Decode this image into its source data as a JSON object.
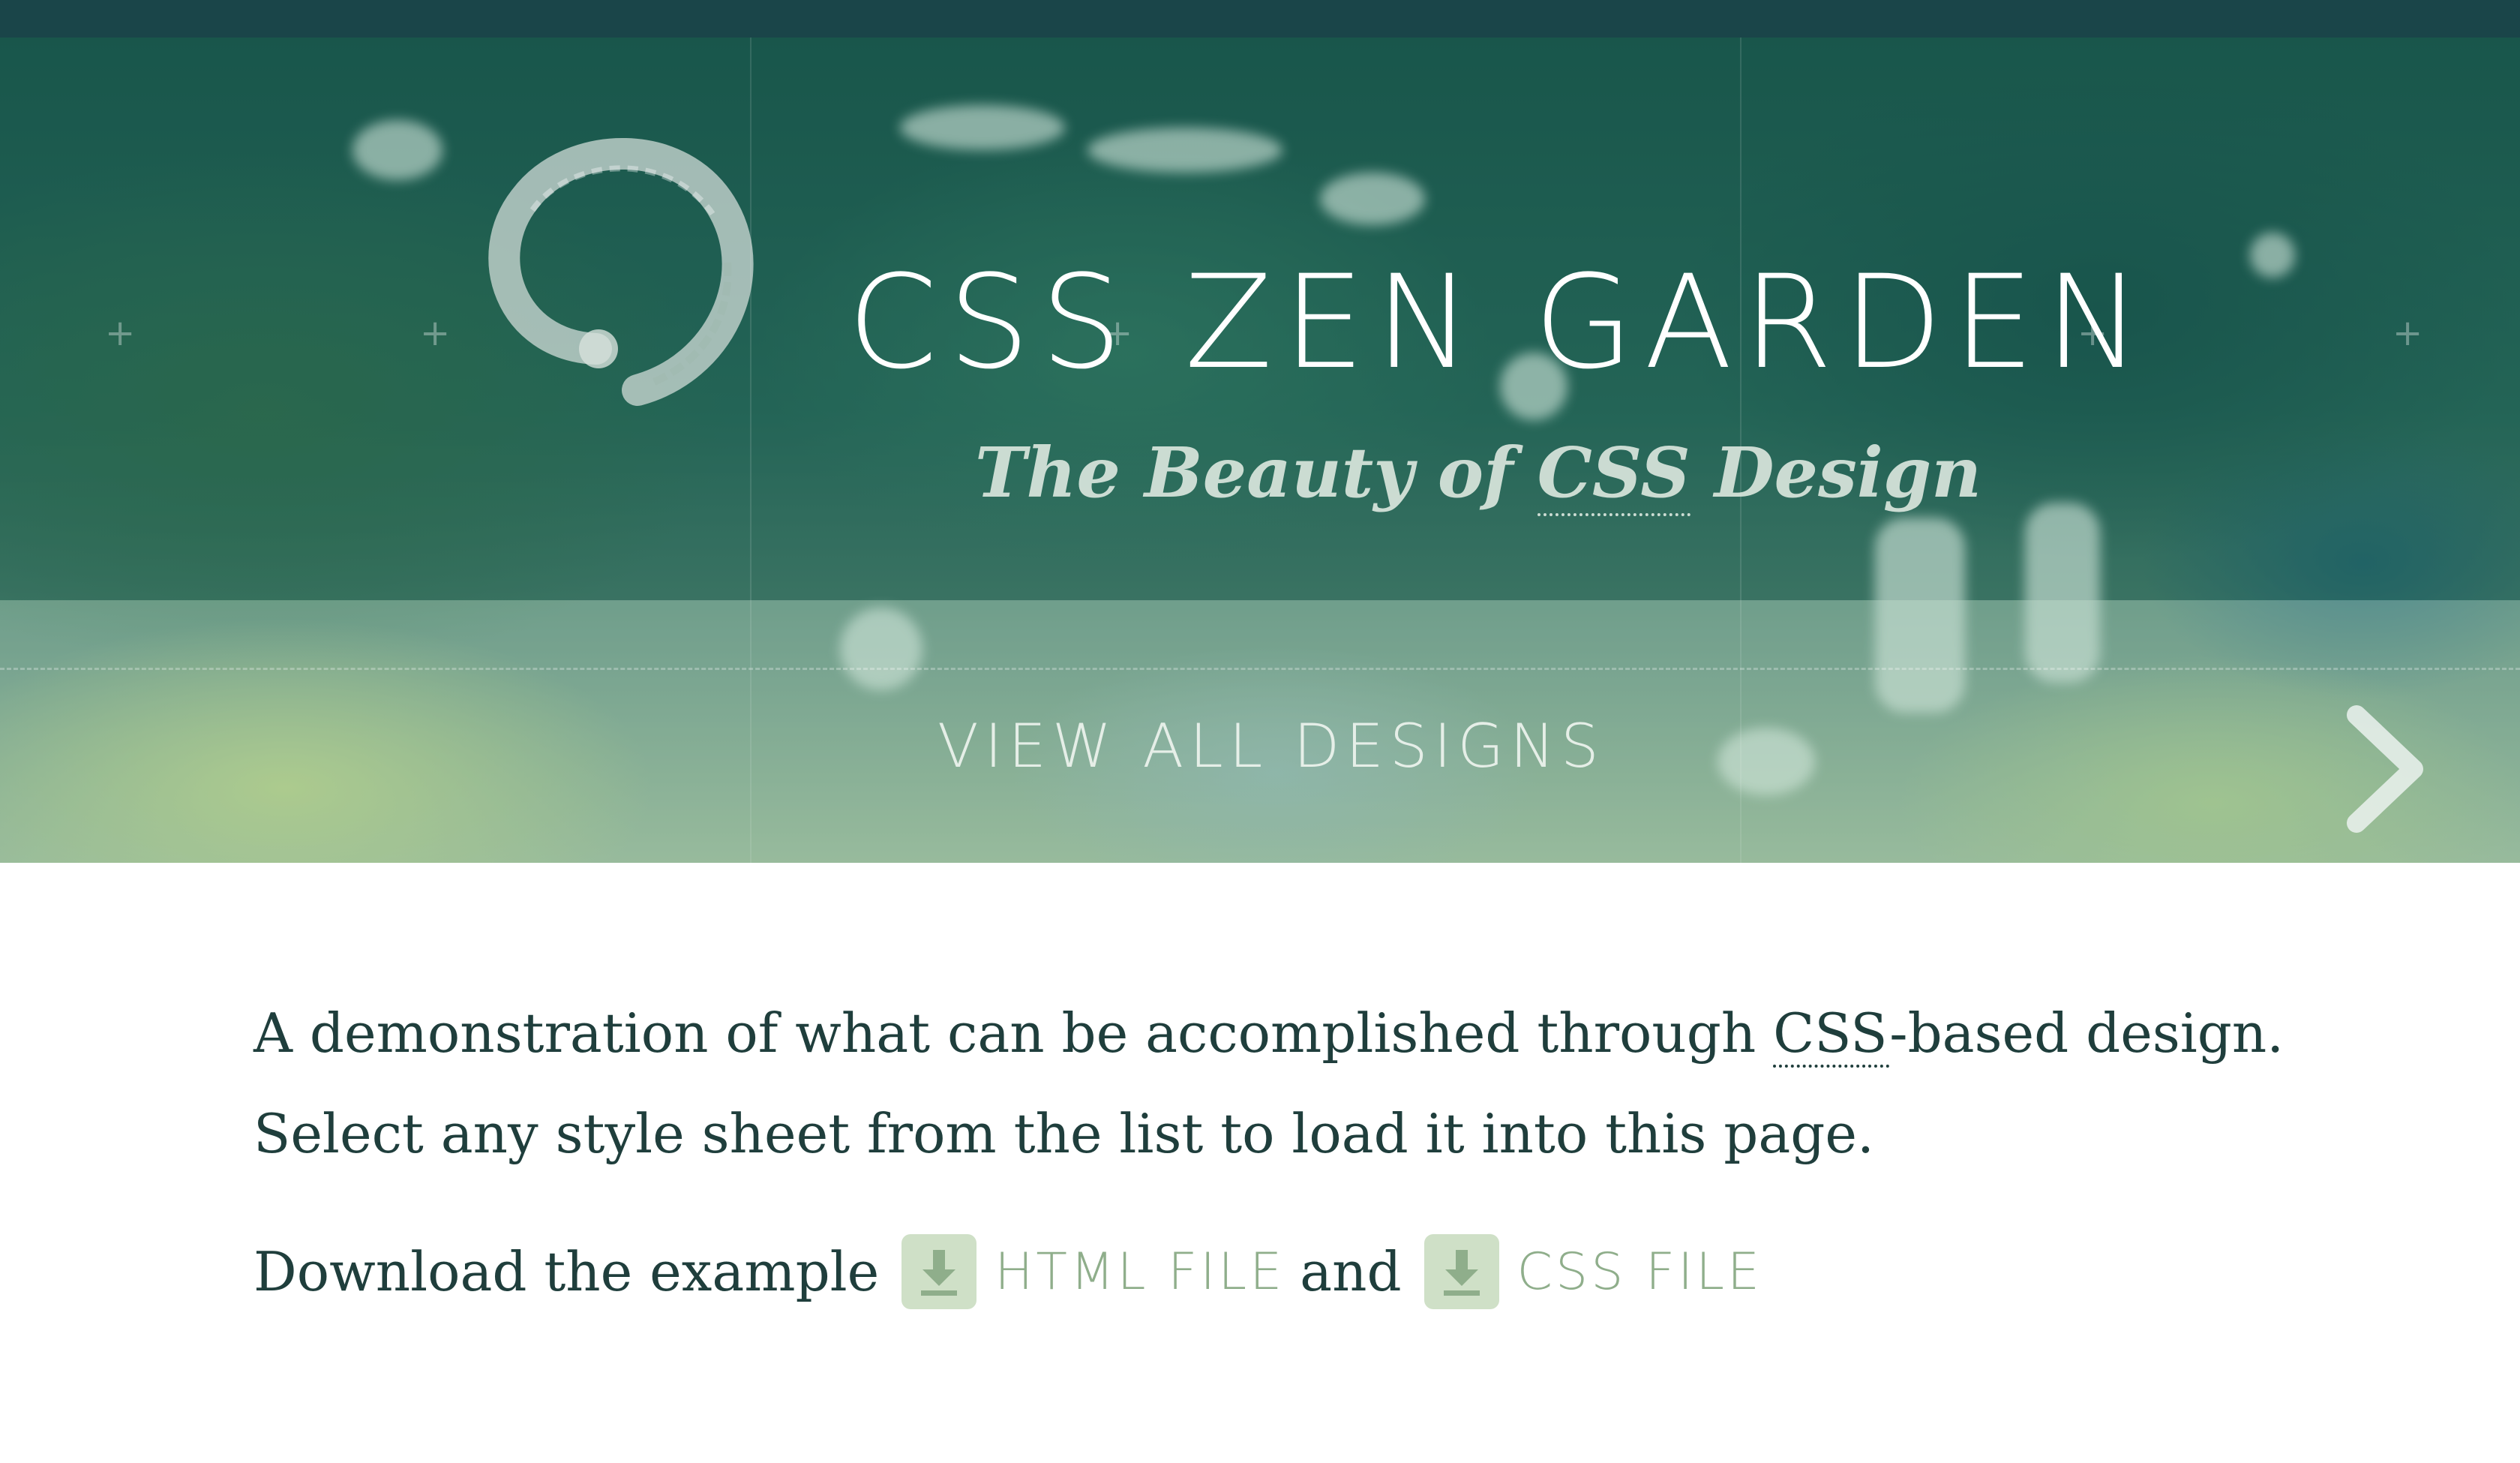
{
  "header": {
    "title": "CSS ZEN GARDEN",
    "tagline_prefix": "The Beauty of ",
    "tagline_abbr": "CSS",
    "tagline_suffix": " Design"
  },
  "designs_nav": {
    "view_all_label": "VIEW ALL DESIGNS",
    "next_icon": "chevron-right-icon"
  },
  "intro": {
    "line1_prefix": "A demonstration of what can be accomplished through ",
    "line1_abbr": "CSS",
    "line1_suffix": "-based design.",
    "line2": "Select any style sheet from the list to load it into this page."
  },
  "downloads": {
    "lead_text": "Download the example",
    "html_label": "HTML FILE",
    "joiner": "and",
    "css_label": "CSS FILE",
    "icon": "download-icon"
  },
  "colors": {
    "top_strip": "#1a4549",
    "body_text": "#1f3e3c",
    "link_green": "#8fae8b",
    "download_icon_bg": "#cfe0c7"
  }
}
